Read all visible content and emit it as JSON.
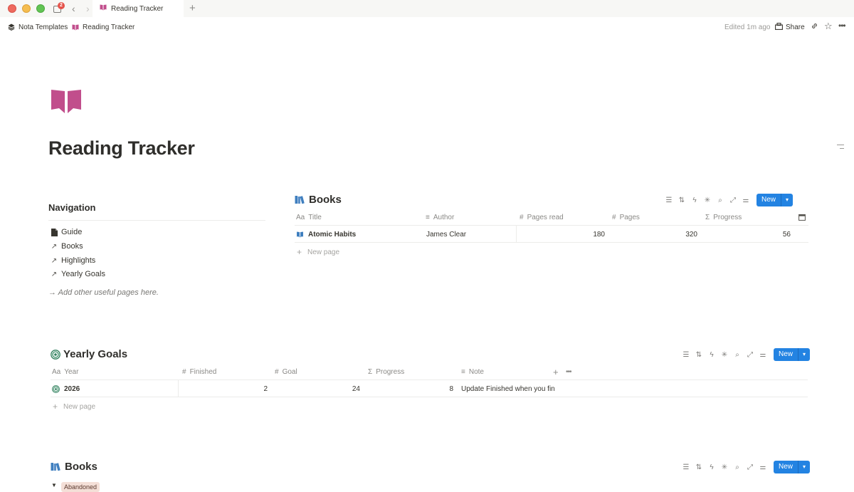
{
  "window": {
    "tab_title": "Reading Tracker",
    "tab_badge": "2"
  },
  "breadcrumb": {
    "workspace": "Nota Templates",
    "page": "Reading Tracker"
  },
  "topbar": {
    "edited": "Edited 1m ago",
    "share": "Share"
  },
  "page": {
    "title": "Reading Tracker",
    "icon": "book-open-icon",
    "icon_color": "#c14e8c"
  },
  "navigation": {
    "heading": "Navigation",
    "items": [
      {
        "label": "Guide",
        "icon": "document-icon"
      },
      {
        "label": "Books",
        "icon": "link-arrow-icon"
      },
      {
        "label": "Highlights",
        "icon": "link-arrow-icon"
      },
      {
        "label": "Yearly Goals",
        "icon": "link-arrow-icon"
      }
    ],
    "note": "→ Add other useful pages here."
  },
  "books_db": {
    "title": "Books",
    "new_label": "New",
    "columns": [
      {
        "label": "Title",
        "icon": "Aa"
      },
      {
        "label": "Author",
        "icon": "text-icon"
      },
      {
        "label": "Pages read",
        "icon": "#"
      },
      {
        "label": "Pages",
        "icon": "#"
      },
      {
        "label": "Progress",
        "icon": "Σ"
      }
    ],
    "rows": [
      {
        "title": "Atomic Habits",
        "author": "James Clear",
        "pages_read": "180",
        "pages": "320",
        "progress": "56"
      }
    ],
    "new_page": "New page"
  },
  "goals_db": {
    "title": "Yearly Goals",
    "new_label": "New",
    "columns": [
      {
        "label": "Year",
        "icon": "Aa"
      },
      {
        "label": "Finished",
        "icon": "#"
      },
      {
        "label": "Goal",
        "icon": "#"
      },
      {
        "label": "Progress",
        "icon": "Σ"
      },
      {
        "label": "Note",
        "icon": "text-icon"
      }
    ],
    "rows": [
      {
        "year": "2026",
        "finished": "2",
        "goal": "24",
        "progress": "8",
        "note": "Update Finished when you fin"
      }
    ],
    "new_page": "New page"
  },
  "books_db2": {
    "title": "Books",
    "new_label": "New",
    "group_label": "Abandoned"
  },
  "colors": {
    "accent": "#2383e2",
    "book_pink": "#c14e8c",
    "book_blue": "#3f7fbf"
  }
}
